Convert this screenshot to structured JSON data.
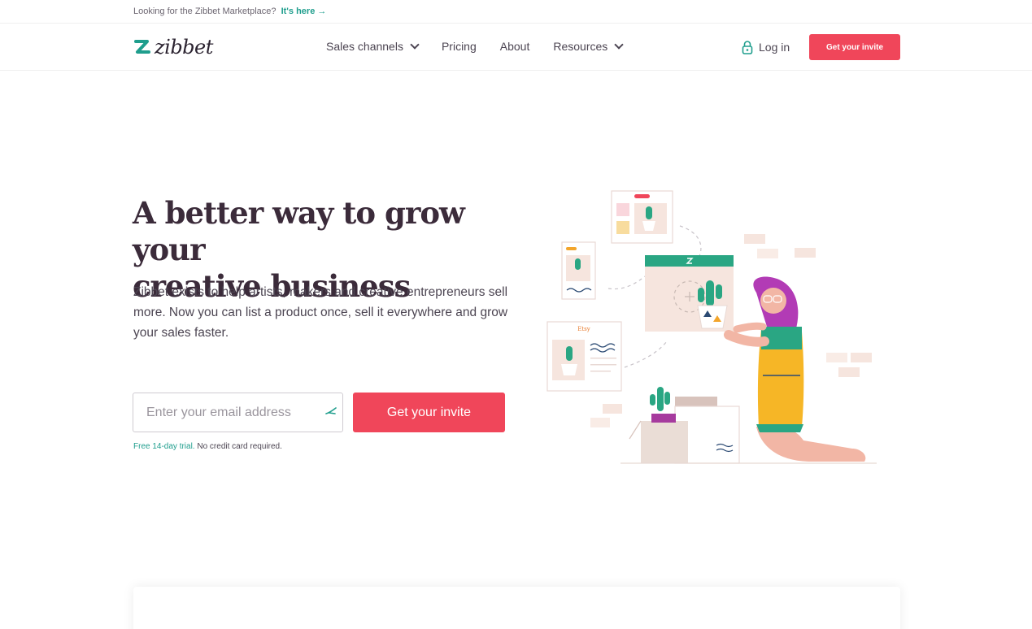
{
  "topbar": {
    "text": "Looking for the Zibbet Marketplace?",
    "link": "It's here →"
  },
  "nav": {
    "logo_text": "zibbet",
    "links": [
      {
        "label": "Sales channels"
      },
      {
        "label": "Pricing"
      },
      {
        "label": "About"
      },
      {
        "label": "Resources"
      }
    ],
    "login": "Log in",
    "cta": "Get your invite"
  },
  "hero": {
    "title_line1": "A better way to grow your",
    "title_line2": "creative business",
    "description": "Zibbet exists to help artists, makers and creative entrepreneurs sell more. Now you can list a product once, sell it everywhere and grow your sales faster.",
    "email_placeholder": "Enter your email address",
    "cta": "Get your invite",
    "trial_accent": "Free 14-day trial.",
    "trial_rest": " No credit card required."
  },
  "illustration": {
    "etsy_label": "Etsy"
  },
  "colors": {
    "accent_red": "#f0465a",
    "accent_teal": "#1f9e8d",
    "heading": "#3b2b3a"
  }
}
